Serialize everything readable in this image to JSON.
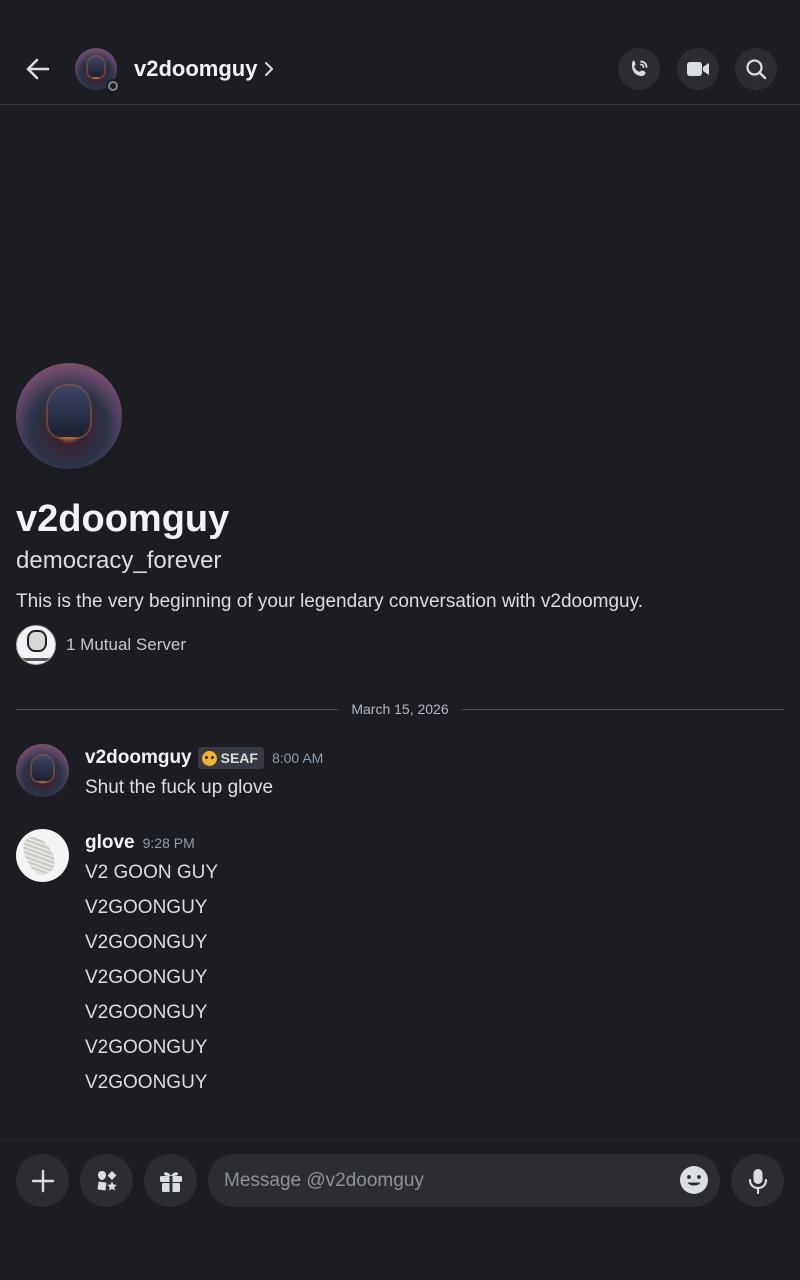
{
  "header": {
    "username": "v2doomguy",
    "icons": [
      "back-arrow-icon",
      "chevron-right-icon",
      "voice-call-icon",
      "video-call-icon",
      "search-icon"
    ]
  },
  "profile": {
    "display_name": "v2doomguy",
    "handle": "democracy_forever",
    "intro": "This is the very beginning of your legendary conversation with v2doomguy.",
    "mutual_servers": "1 Mutual Server"
  },
  "date_divider": "March 15, 2026",
  "messages": [
    {
      "author": "v2doomguy",
      "tag": "SEAF",
      "time": "8:00 AM",
      "lines": [
        "Shut the fuck up glove"
      ]
    },
    {
      "author": "glove",
      "time": "9:28 PM",
      "lines": [
        "V2 GOON GUY",
        "V2GOONGUY",
        "V2GOONGUY",
        "V2GOONGUY",
        "V2GOONGUY",
        "V2GOONGUY",
        "V2GOONGUY"
      ]
    }
  ],
  "composer": {
    "placeholder": "Message @v2doomguy",
    "icons": [
      "plus-icon",
      "apps-icon",
      "gift-icon",
      "emoji-icon",
      "microphone-icon"
    ]
  },
  "colors": {
    "background": "#1c1d23",
    "button": "#2b2d33",
    "text": "#f2f3f5",
    "muted": "#949ba4"
  }
}
